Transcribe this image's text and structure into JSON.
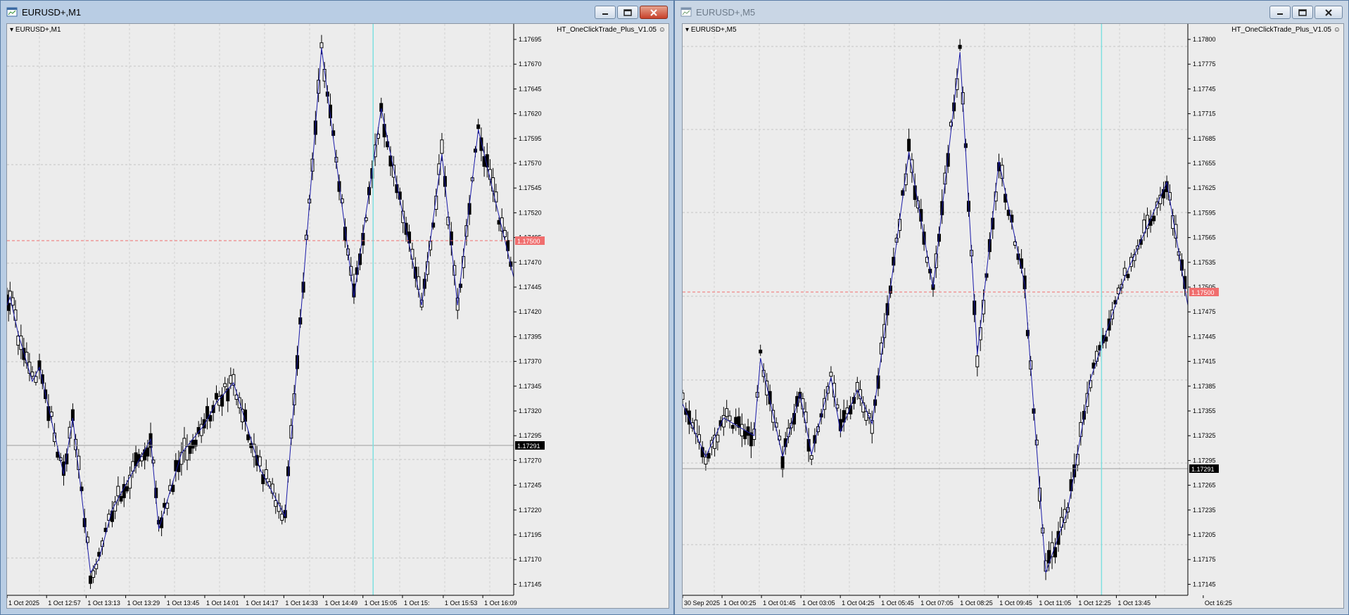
{
  "windows": [
    {
      "title": "EURUSD+,M1",
      "symbol_label": "EURUSD+,M1",
      "ea_label": "HT_OneClickTrade_Plus_V1.05",
      "ea_icon": "smiley-icon",
      "price_axis": [
        "1.17695",
        "1.17670",
        "1.17645",
        "1.17620",
        "1.17595",
        "1.17570",
        "1.17545",
        "1.17520",
        "1.17495",
        "1.17470",
        "1.17445",
        "1.17420",
        "1.17395",
        "1.17370",
        "1.17345",
        "1.17320",
        "1.17295",
        "1.17270",
        "1.17245",
        "1.17220",
        "1.17195",
        "1.17170",
        "1.17145"
      ],
      "bid_label": "1.17291",
      "level_label": "1.17500",
      "time_axis": [
        "1 Oct 2025",
        "1 Oct 12:57",
        "1 Oct 13:13",
        "1 Oct 13:29",
        "1 Oct 13:45",
        "1 Oct 14:01",
        "1 Oct 14:17",
        "1 Oct 14:33",
        "1 Oct 14:49",
        "1 Oct 15:05",
        "1 Oct 15:",
        "1 Oct 15:53",
        "1 Oct 16:09"
      ],
      "colors": {
        "zigzag": "#1a1aa8",
        "level": "#f06e6e",
        "cursor": "#7fe0e0",
        "bid": "#000000"
      }
    },
    {
      "title": "EURUSD+,M5",
      "symbol_label": "EURUSD+,M5",
      "ea_label": "HT_OneClickTrade_Plus_V1.05",
      "ea_icon": "smiley-icon",
      "price_axis": [
        "1.17800",
        "1.17775",
        "1.17745",
        "1.17715",
        "1.17685",
        "1.17655",
        "1.17625",
        "1.17595",
        "1.17565",
        "1.17535",
        "1.17505",
        "1.17475",
        "1.17445",
        "1.17415",
        "1.17385",
        "1.17355",
        "1.17325",
        "1.17295",
        "1.17265",
        "1.17235",
        "1.17205",
        "1.17175",
        "1.17145"
      ],
      "bid_label": "1.17291",
      "level_label": "1.17500",
      "time_axis": [
        "30 Sep 2025",
        "1 Oct 00:25",
        "1 Oct 01:45",
        "1 Oct 03:05",
        "1 Oct 04:25",
        "1 Oct 05:45",
        "1 Oct 07:05",
        "1 Oct 08:25",
        "1 Oct 09:45",
        "1 Oct 11:05",
        "1 Oct 12:25",
        "1 Oct 13:45",
        "",
        "Oct 16:25"
      ],
      "colors": {
        "zigzag": "#1a1aa8",
        "level": "#f06e6e",
        "cursor": "#7fe0e0",
        "bid": "#000000"
      }
    }
  ]
}
